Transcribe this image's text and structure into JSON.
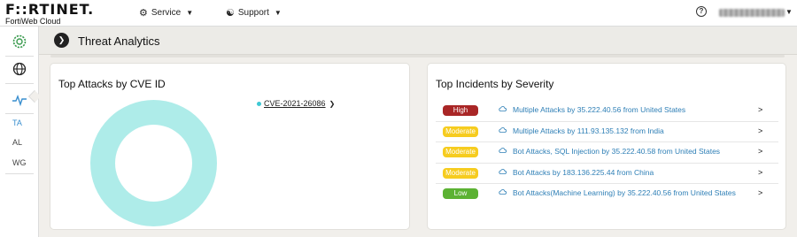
{
  "brand": {
    "name": "F::RTINET.",
    "product": "FortiWeb Cloud"
  },
  "nav": [
    {
      "label": "Service",
      "icon": "service-icon"
    },
    {
      "label": "Support",
      "icon": "support-icon"
    }
  ],
  "sidebar": {
    "icons": [
      "settings-gear-icon",
      "globe-icon",
      "activity-pulse-icon"
    ],
    "items": [
      {
        "label": "TA",
        "active": true
      },
      {
        "label": "AL",
        "active": false
      },
      {
        "label": "WG",
        "active": false
      }
    ]
  },
  "page": {
    "title": "Threat Analytics"
  },
  "cve_card": {
    "title": "Top Attacks by CVE ID",
    "legend": [
      {
        "label": "CVE-2021-26086",
        "color": "#3ec8d4"
      }
    ]
  },
  "chart_data": {
    "type": "pie",
    "donut": true,
    "categories": [
      "CVE-2021-26086"
    ],
    "values": [
      100
    ],
    "colors": [
      "#aeece9"
    ],
    "title": "Top Attacks by CVE ID"
  },
  "incidents_card": {
    "title": "Top Incidents by Severity",
    "items": [
      {
        "severity": "High",
        "level": "high",
        "text": "Multiple Attacks by 35.222.40.56 from United States"
      },
      {
        "severity": "Moderate",
        "level": "moderate",
        "text": "Multiple Attacks by 111.93.135.132 from India"
      },
      {
        "severity": "Moderate",
        "level": "moderate",
        "text": "Bot Attacks, SQL Injection by 35.222.40.58 from United States"
      },
      {
        "severity": "Moderate",
        "level": "moderate",
        "text": "Bot Attacks by 183.136.225.44 from China"
      },
      {
        "severity": "Low",
        "level": "low",
        "text": "Bot Attacks(Machine Learning) by 35.222.40.56 from United States"
      }
    ]
  },
  "colors": {
    "accent": "#2e7fb6",
    "high": "#a92626",
    "moderate": "#f6cc1f",
    "low": "#5cb233",
    "cve": "#aeece9"
  }
}
